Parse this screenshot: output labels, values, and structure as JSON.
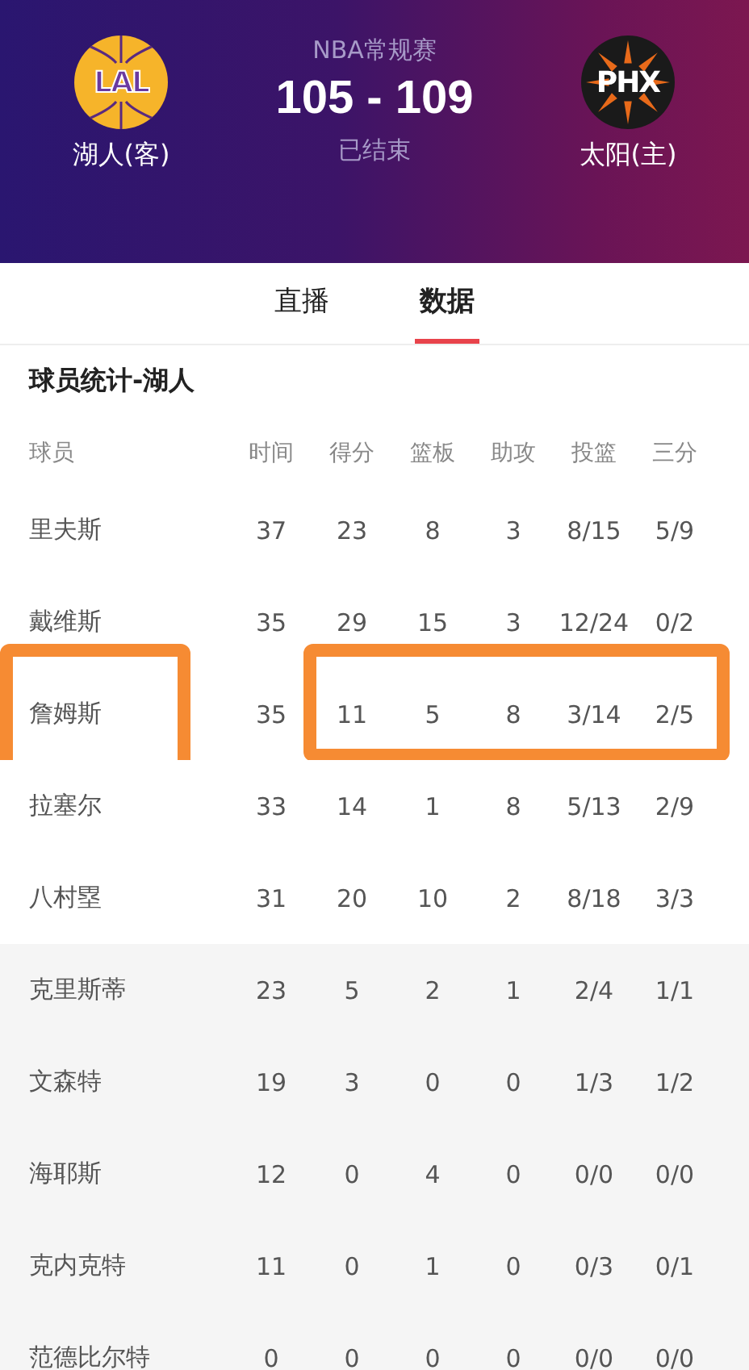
{
  "match": {
    "league": "NBA常规赛",
    "score": "105 - 109",
    "status": "已结束",
    "away": {
      "logo_text": "LAL",
      "name": "湖人(客)",
      "kind": "lakers"
    },
    "home": {
      "logo_text": "PHX",
      "name": "太阳(主)",
      "kind": "suns"
    }
  },
  "tabs": [
    {
      "label": "直播",
      "selected": false
    },
    {
      "label": "数据",
      "selected": true
    }
  ],
  "section_title": "球员统计-湖人",
  "table": {
    "columns": [
      "球员",
      "时间",
      "得分",
      "篮板",
      "助攻",
      "投篮",
      "三分"
    ],
    "rows": [
      {
        "cells": [
          "里夫斯",
          "37",
          "23",
          "8",
          "3",
          "8/15",
          "5/9"
        ],
        "bench": false,
        "marked": false
      },
      {
        "cells": [
          "戴维斯",
          "35",
          "29",
          "15",
          "3",
          "12/24",
          "0/2"
        ],
        "bench": false,
        "marked": false
      },
      {
        "cells": [
          "詹姆斯",
          "35",
          "11",
          "5",
          "8",
          "3/14",
          "2/5"
        ],
        "bench": false,
        "marked": true
      },
      {
        "cells": [
          "拉塞尔",
          "33",
          "14",
          "1",
          "8",
          "5/13",
          "2/9"
        ],
        "bench": false,
        "marked": false
      },
      {
        "cells": [
          "八村塁",
          "31",
          "20",
          "10",
          "2",
          "8/18",
          "3/3"
        ],
        "bench": false,
        "marked": false
      },
      {
        "cells": [
          "克里斯蒂",
          "23",
          "5",
          "2",
          "1",
          "2/4",
          "1/1"
        ],
        "bench": true,
        "marked": false
      },
      {
        "cells": [
          "文森特",
          "19",
          "3",
          "0",
          "0",
          "1/3",
          "1/2"
        ],
        "bench": true,
        "marked": false
      },
      {
        "cells": [
          "海耶斯",
          "12",
          "0",
          "4",
          "0",
          "0/0",
          "0/0"
        ],
        "bench": true,
        "marked": false
      },
      {
        "cells": [
          "克内克特",
          "11",
          "0",
          "1",
          "0",
          "0/3",
          "0/1"
        ],
        "bench": true,
        "marked": false
      },
      {
        "cells": [
          "范德比尔特",
          "0",
          "0",
          "0",
          "0",
          "0/0",
          "0/0"
        ],
        "bench": true,
        "marked": false
      }
    ]
  }
}
